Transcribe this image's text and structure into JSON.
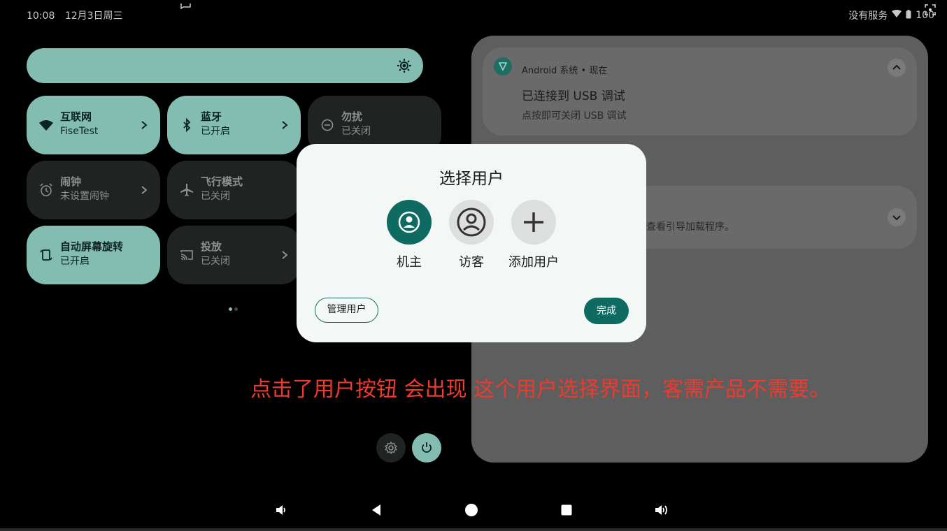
{
  "status_bar": {
    "time": "10:08",
    "date": "12月3日周三",
    "carrier": "没有服务",
    "battery": "100"
  },
  "quick_settings": {
    "tiles": [
      {
        "label": "互联网",
        "status": "FiseTest",
        "icon": "wifi-icon",
        "state": "on"
      },
      {
        "label": "蓝牙",
        "status": "已开启",
        "icon": "bluetooth-icon",
        "state": "on"
      },
      {
        "label": "勿扰",
        "status": "已关闭",
        "icon": "dnd-icon",
        "state": "off"
      },
      {
        "label": "闹钟",
        "status": "未设置闹钟",
        "icon": "alarm-icon",
        "state": "off"
      },
      {
        "label": "飞行模式",
        "status": "已关闭",
        "icon": "airplane-icon",
        "state": "off"
      },
      {
        "label": "自动屏幕旋转",
        "status": "已开启",
        "icon": "rotate-icon",
        "state": "on"
      },
      {
        "label": "投放",
        "status": "已关闭",
        "icon": "cast-icon",
        "state": "off"
      }
    ]
  },
  "notifications": [
    {
      "app": "Android 系统 • 现在",
      "title": "已连接到 USB 调试",
      "text": "点按即可关闭 USB 调试"
    },
    {
      "text": "查看引导加载程序。"
    }
  ],
  "dialog": {
    "title": "选择用户",
    "users": [
      {
        "label": "机主",
        "icon": "owner-user-icon"
      },
      {
        "label": "访客",
        "icon": "guest-user-icon"
      },
      {
        "label": "添加用户",
        "icon": "add-user-icon"
      }
    ],
    "manage_label": "管理用户",
    "done_label": "完成"
  },
  "annotation": "点击了用户按钮 会出现 这个用户选择界面，客需产品不需要。",
  "colors": {
    "tile_on": "#83bcb0",
    "tile_off": "#1f2422",
    "accent": "#0f6b62",
    "annotation": "#ee3a2e"
  }
}
